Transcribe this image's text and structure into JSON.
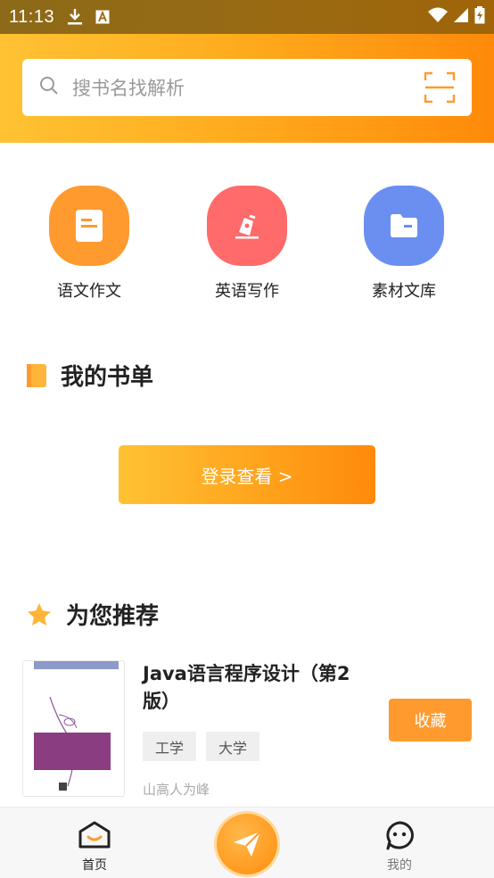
{
  "status_bar": {
    "time": "11:13"
  },
  "search": {
    "placeholder": "搜书名找解析"
  },
  "categories": [
    {
      "label": "语文作文",
      "color": "#ff9a2f",
      "icon": "document-icon"
    },
    {
      "label": "英语写作",
      "color": "#ff6b6b",
      "icon": "pen-icon"
    },
    {
      "label": "素材文库",
      "color": "#6a8ff0",
      "icon": "folder-icon"
    }
  ],
  "booklist": {
    "title": "我的书单",
    "login_button": "登录查看  >"
  },
  "recommend": {
    "title": "为您推荐",
    "book": {
      "title": "Java语言程序设计（第2版）",
      "tags": [
        "工学",
        "大学"
      ],
      "author": "山高人为峰",
      "favorite_button": "收藏"
    }
  },
  "bottom_nav": {
    "home_label": "首页",
    "mine_label": "我的"
  },
  "colors": {
    "accent_start": "#ffc233",
    "accent_end": "#ff8a0a"
  }
}
